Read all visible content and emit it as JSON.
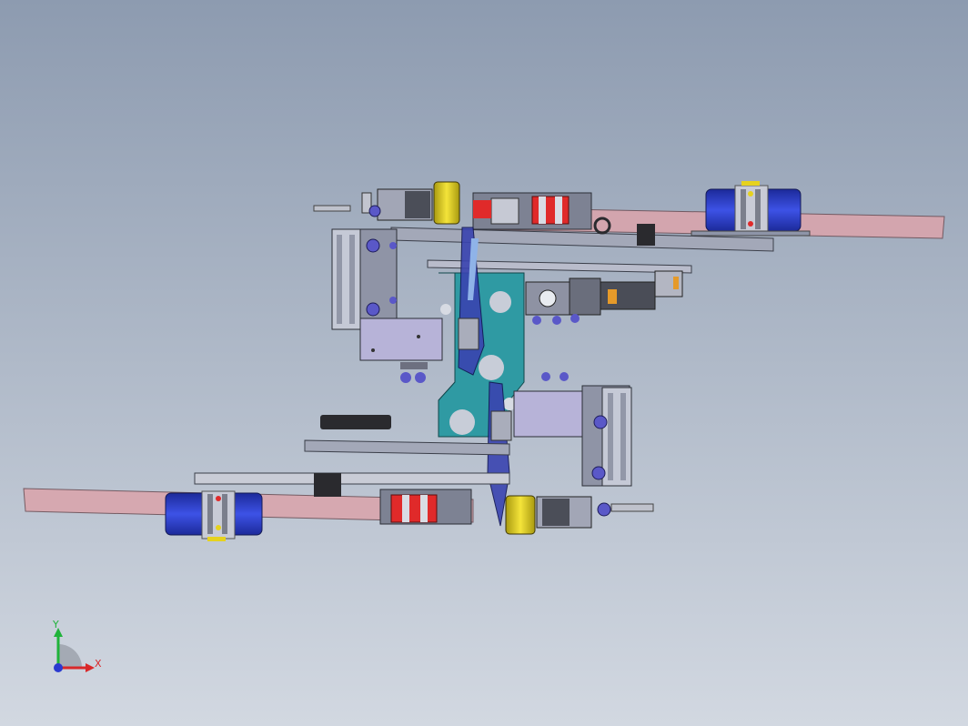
{
  "viewport": {
    "background_top": "#8d9bb0",
    "background_bottom": "#d2d8e1"
  },
  "model": {
    "belt_color": "#d9a5ad",
    "motor_color": "#2c3fd0",
    "teal_plate_color": "#2f9aa3",
    "cylinder_color": "#e6d21e",
    "red_roller_color": "#e02a2a",
    "fitting_color": "#5a58c8",
    "frame_color": "#9aa0b2",
    "orange_part_color": "#e59a2a",
    "dark_part_color": "#2a2a2e"
  },
  "triad": {
    "y_label": "Y",
    "x_label": "X",
    "y_color": "#1fb33a",
    "x_color": "#d9282a",
    "z_color": "#2a3ad0"
  }
}
